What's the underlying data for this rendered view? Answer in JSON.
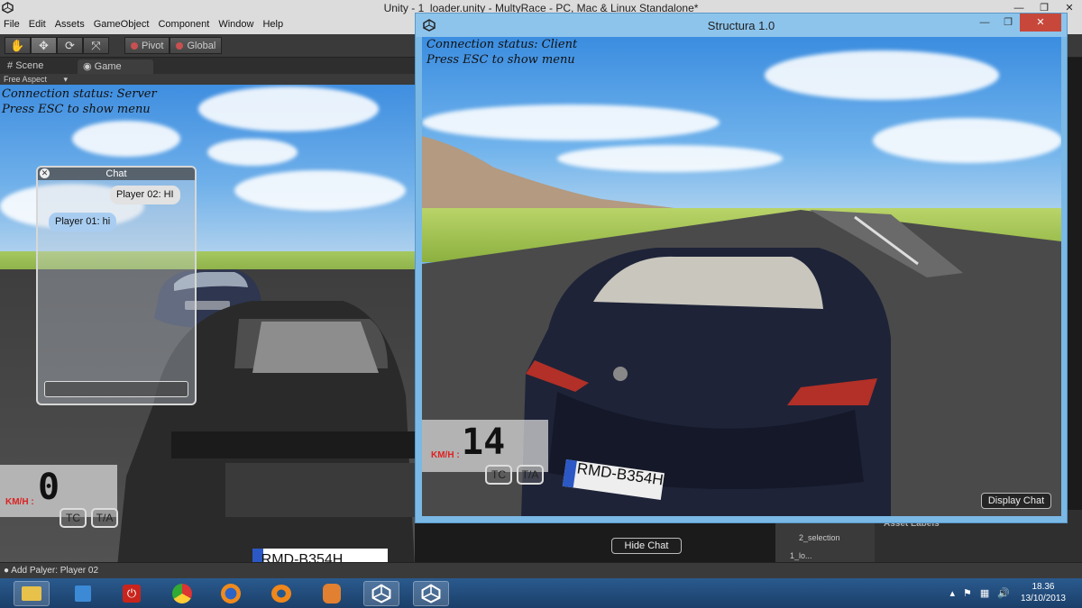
{
  "editor": {
    "window_title": "Unity - 1_loader.unity - MultyRace - PC, Mac & Linux Standalone*",
    "menu": [
      "File",
      "Edit",
      "Assets",
      "GameObject",
      "Component",
      "Window",
      "Help"
    ],
    "toolbar": {
      "pivot_label": "Pivot",
      "global_label": "Global"
    },
    "tabs": [
      {
        "label": "Scene",
        "icon": "scene-icon"
      },
      {
        "label": "Game",
        "icon": "game-icon"
      }
    ],
    "aspect_label": "Free Aspect",
    "status_message": "Add Palyer: Player 02",
    "side_panel": {
      "asset_labels_title": "Asset Labels",
      "item_1": "2_selection",
      "item_2": "1_lo..."
    }
  },
  "server_view": {
    "connection_status": "Connection status: Server",
    "hint": "Press ESC to show menu",
    "chat": {
      "title": "Chat",
      "messages": [
        {
          "text": "Player 02: HI",
          "side": "right",
          "color": "#e2e2e2"
        },
        {
          "text": "Player 01: hi",
          "side": "left",
          "color": "#a9cdf1"
        }
      ],
      "input_value": ""
    },
    "speed": {
      "unit": "KM/H :",
      "value": "0"
    },
    "tc_label": "TC",
    "ta_label": "T/A",
    "hide_chat_label": "Hide Chat",
    "plate": "RMD-B354H"
  },
  "client_window": {
    "title": "Structura 1.0",
    "connection_status": "Connection status: Client",
    "hint": "Press ESC to show menu",
    "speed": {
      "unit": "KM/H :",
      "value": "14"
    },
    "tc_label": "TC",
    "ta_label": "T/A",
    "display_chat_label": "Display Chat",
    "plate": "RMD-B354H"
  },
  "taskbar": {
    "apps": [
      "file-explorer-icon",
      "control-panel-icon",
      "power-app-icon",
      "chrome-icon",
      "firefox-icon",
      "blender-icon",
      "app-hand-icon",
      "unity-icon",
      "unity-icon"
    ],
    "time": "18.36",
    "date": "13/10/2013"
  },
  "colors": {
    "unity_dark": "#3a3a3a",
    "client_frame": "#7ab8e6",
    "close_red": "#c7483b",
    "speed_unit": "#dd2222",
    "taskbar": "#1b3f6a"
  }
}
